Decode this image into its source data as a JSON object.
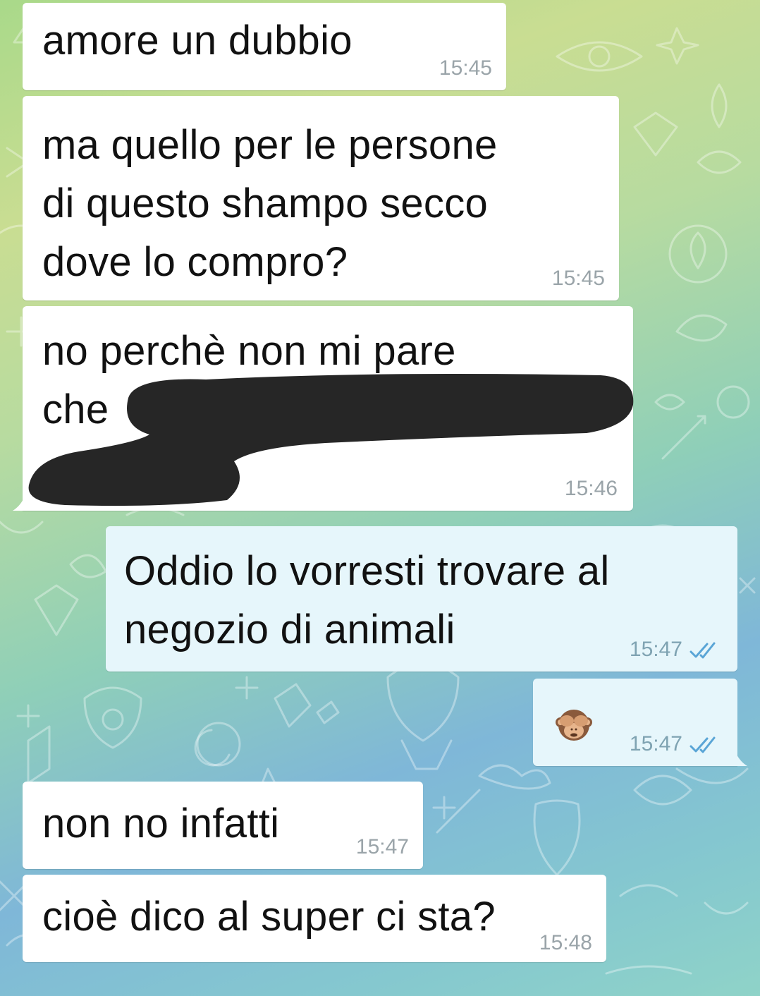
{
  "chat": {
    "messages": [
      {
        "direction": "in",
        "text": "amore un dubbio",
        "time": "15:45"
      },
      {
        "direction": "in",
        "text": "ma quello per le persone\ndi questo shampo secco\ndove lo compro?",
        "time": "15:45"
      },
      {
        "direction": "in",
        "text": "no perchè non mi pare\nche",
        "time": "15:46",
        "redacted": true
      },
      {
        "direction": "out",
        "text": "Oddio lo vorresti trovare al\nnegozio di animali",
        "time": "15:47",
        "status": "read"
      },
      {
        "direction": "out",
        "emoji": "see-no-evil-monkey",
        "time": "15:47",
        "status": "read"
      },
      {
        "direction": "in",
        "text": "non no infatti",
        "time": "15:47"
      },
      {
        "direction": "in",
        "text": "cioè dico al super ci sta?",
        "time": "15:48"
      }
    ]
  },
  "theme": {
    "incoming_bubble": "#ffffff",
    "outgoing_bubble": "#e6f6fb",
    "time_color": "#9aa4a9",
    "read_tick_color": "#5aa5d6",
    "redaction_color": "#262626"
  }
}
